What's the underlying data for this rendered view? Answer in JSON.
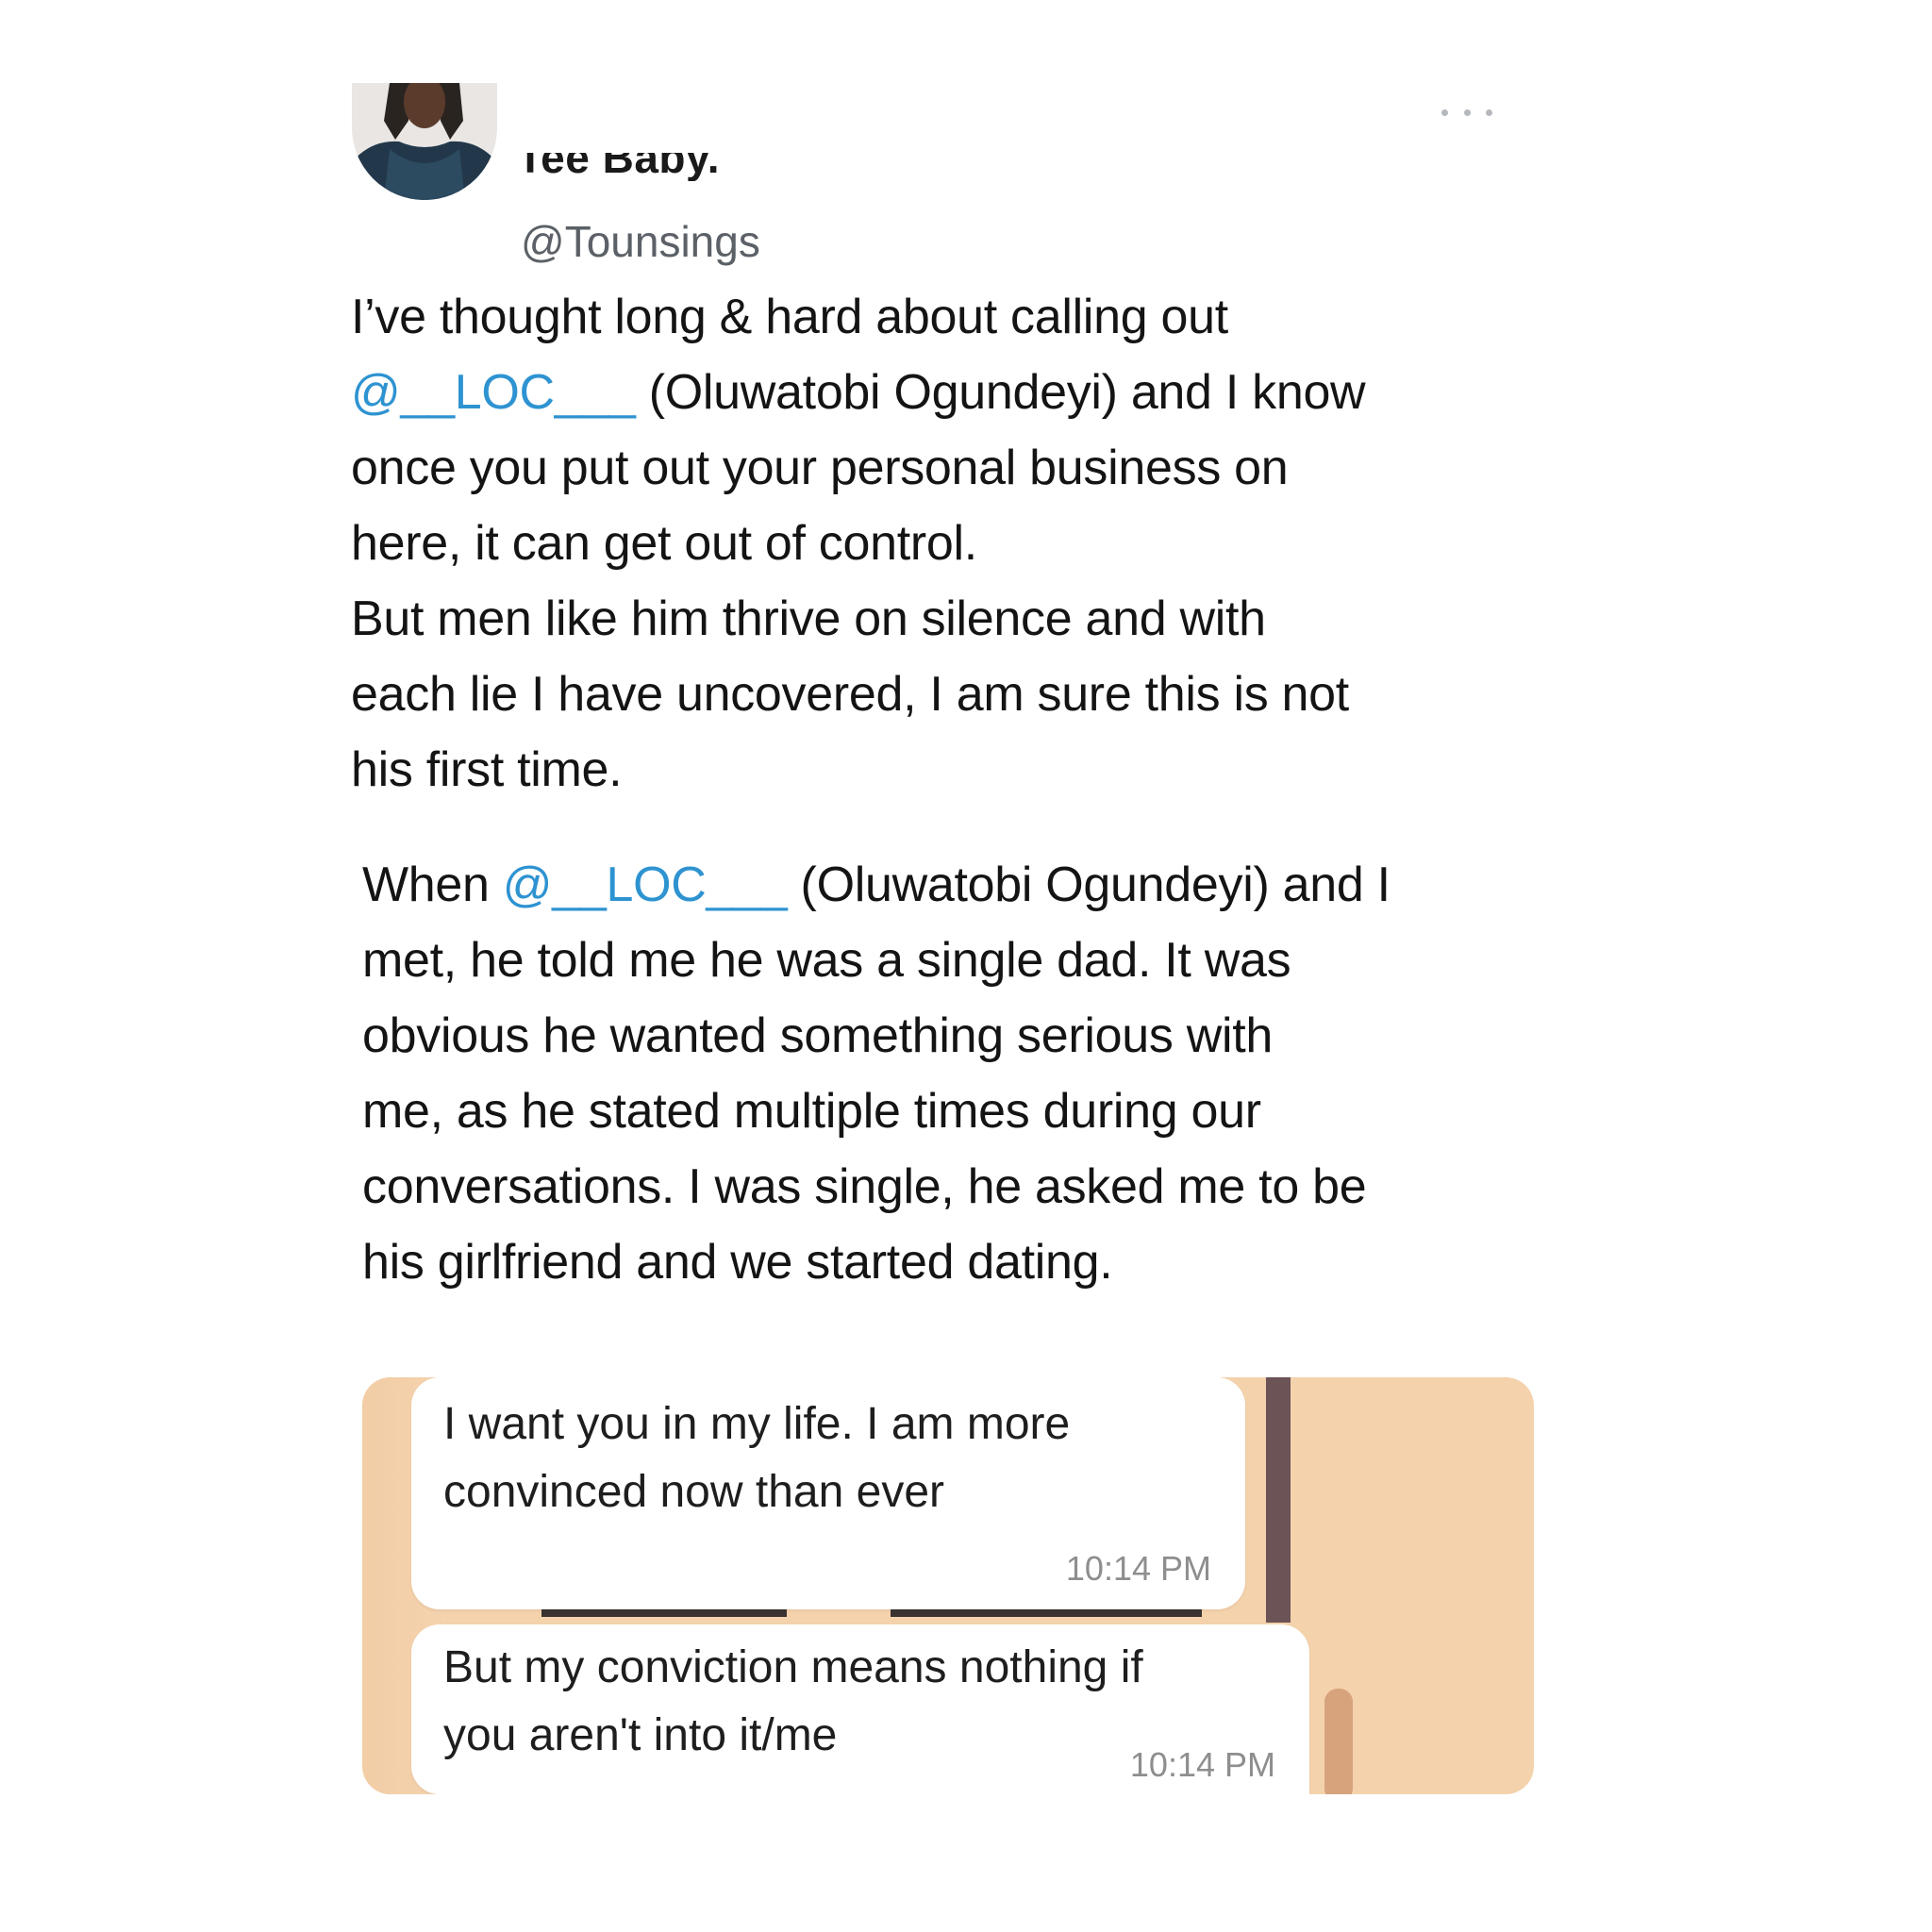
{
  "tweet": {
    "author": {
      "display_name": "Tee Baby.",
      "handle": "@Tounsings",
      "avatar_icon": "avatar-photo"
    },
    "more_icon": "more-horizontal-icon",
    "paragraph_1": {
      "line_1": "I’ve thought long & hard about calling out",
      "line_2_mention": "@__LOC___",
      "line_2_rest": " (Oluwatobi Ogundeyi) and I know",
      "line_3": "once you put out your personal business on",
      "line_4": "here, it can get out of control.",
      "line_5": "But men like him thrive on silence and with",
      "line_6": "each lie I have uncovered, I am sure this is not",
      "line_7": "his first time."
    },
    "paragraph_2": {
      "line_1_prefix": "When ",
      "line_1_mention": "@__LOC___",
      "line_1_rest": " (Oluwatobi Ogundeyi) and I",
      "line_2": "met, he told me he was a single dad. It was",
      "line_3": "obvious he wanted something serious with",
      "line_4": "me, as he stated multiple times during our",
      "line_5": "conversations. I was single, he asked me to be",
      "line_6": "his girlfriend and we started dating."
    },
    "mention_color": "#2e93d1"
  },
  "chat_screenshot": {
    "messages": [
      {
        "line_1": "I want you in my life. I am more",
        "line_2": "convinced now than ever",
        "time": "10:14 PM"
      },
      {
        "line_1": "But my conviction means nothing if",
        "line_2": "you aren't into it/me",
        "time": "10:14 PM"
      }
    ],
    "background_color": "#f4d2ac"
  }
}
